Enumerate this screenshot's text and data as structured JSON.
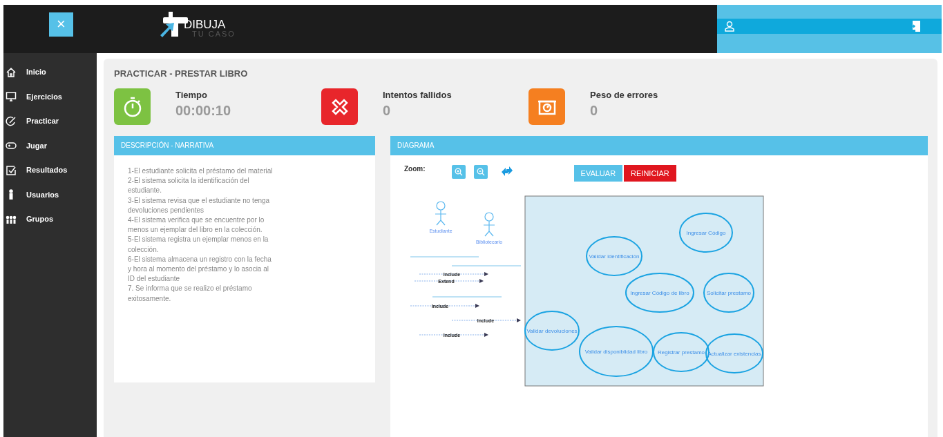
{
  "header": {
    "logo_main": "DIBUJA",
    "logo_sub": "TU CASO",
    "close_label": "×"
  },
  "sidebar": {
    "items": [
      {
        "label": "Inicio"
      },
      {
        "label": "Ejercicios"
      },
      {
        "label": "Practicar"
      },
      {
        "label": "Jugar"
      },
      {
        "label": "Resultados"
      },
      {
        "label": "Usuarios"
      },
      {
        "label": "Grupos"
      }
    ]
  },
  "page_title": "PRACTICAR - PRESTAR LIBRO",
  "stats": [
    {
      "kind": "timer",
      "label": "Tiempo",
      "value": "00:00:10"
    },
    {
      "kind": "errors",
      "label": "Intentos fallidos",
      "value": "0"
    },
    {
      "kind": "weight",
      "label": "Peso de errores",
      "value": "0"
    }
  ],
  "narrative": {
    "title": "DESCRIPCIÓN - NARRATIVA",
    "lines": [
      "1-El estudiante solicita el préstamo del material",
      "2-El sistema solicita la identificación del estudiante.",
      "3-El sistema revisa que el estudiante no tenga devoluciones pendientes",
      "4-El sistema verifica que se encuentre por lo menos un ejemplar del libro en la colección.",
      "5-El sistema registra un ejemplar menos en la colección.",
      "6-El sistema almacena un registro con la fecha y hora al momento del préstamo y lo asocia al ID del estudiante",
      "7. Se informa que se realizo el préstamo exitosamente."
    ]
  },
  "diagram": {
    "title": "DIAGRAMA",
    "zoom_label": "Zoom:",
    "buttons": [
      {
        "kind": "primary",
        "label": "EVALUAR"
      },
      {
        "kind": "danger",
        "label": "REINICIAR"
      }
    ],
    "actors": [
      {
        "name": "Estudiante"
      },
      {
        "name": "Bibliotecario"
      }
    ],
    "relations": [
      {
        "label": "Include"
      },
      {
        "label": "Extend"
      },
      {
        "label": "Include"
      },
      {
        "label": "Include"
      },
      {
        "label": "Include"
      }
    ],
    "use_cases": [
      {
        "name": "Ingresar Código"
      },
      {
        "name": "Validar identificación"
      },
      {
        "name": "Ingresar Código de libro"
      },
      {
        "name": "Solicitar prestamo"
      },
      {
        "name": "Validar devoluciones"
      },
      {
        "name": "Validar disponiblidad libro"
      },
      {
        "name": "Registrar prestamo"
      },
      {
        "name": "Actualizar existencias"
      }
    ]
  }
}
